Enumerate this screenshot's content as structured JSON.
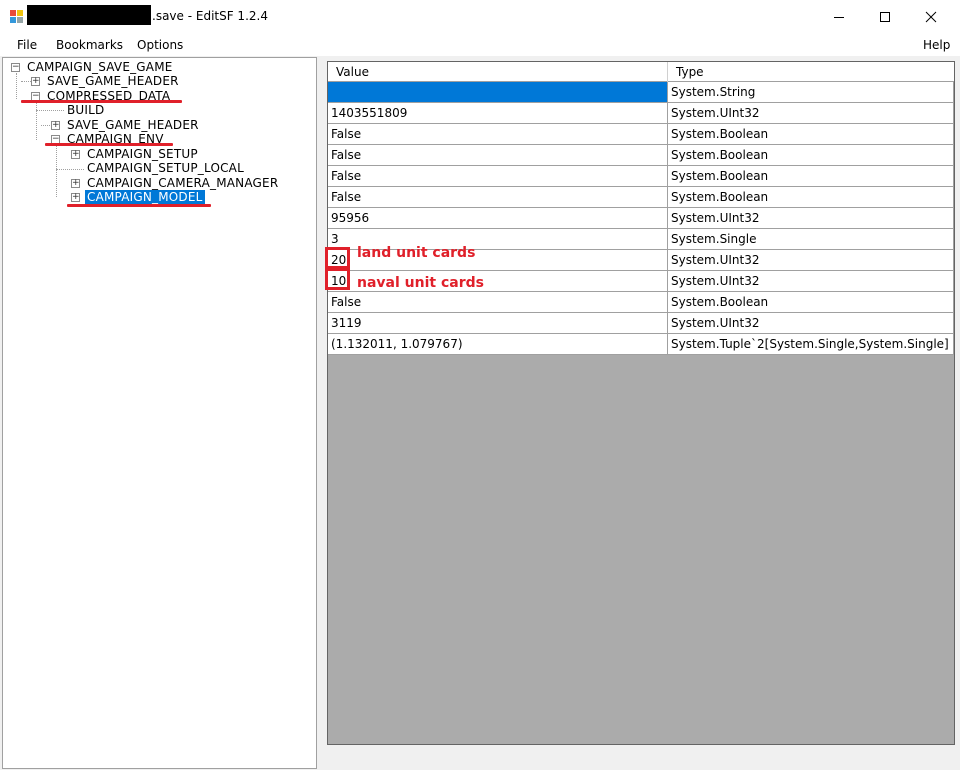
{
  "window": {
    "title_suffix": ".save - EditSF 1.2.4"
  },
  "menu": {
    "file": "File",
    "bookmarks": "Bookmarks",
    "options": "Options",
    "help": "Help"
  },
  "tree": {
    "nodes": [
      {
        "label": "CAMPAIGN_SAVE_GAME",
        "expander": "minus"
      },
      {
        "label": "SAVE_GAME_HEADER",
        "expander": "plus"
      },
      {
        "label": "COMPRESSED_DATA",
        "expander": "minus"
      },
      {
        "label": "BUILD",
        "expander": "none"
      },
      {
        "label": "SAVE_GAME_HEADER",
        "expander": "plus"
      },
      {
        "label": "CAMPAIGN_ENV",
        "expander": "minus"
      },
      {
        "label": "CAMPAIGN_SETUP",
        "expander": "plus"
      },
      {
        "label": "CAMPAIGN_SETUP_LOCAL",
        "expander": "none"
      },
      {
        "label": "CAMPAIGN_CAMERA_MANAGER",
        "expander": "plus"
      },
      {
        "label": "CAMPAIGN_MODEL",
        "expander": "plus",
        "selected": true
      }
    ]
  },
  "grid": {
    "headers": {
      "value": "Value",
      "type": "Type"
    },
    "rows": [
      {
        "value": "",
        "type": "System.String",
        "selected": true
      },
      {
        "value": "1403551809",
        "type": "System.UInt32"
      },
      {
        "value": "False",
        "type": "System.Boolean"
      },
      {
        "value": "False",
        "type": "System.Boolean"
      },
      {
        "value": "False",
        "type": "System.Boolean"
      },
      {
        "value": "False",
        "type": "System.Boolean"
      },
      {
        "value": "95956",
        "type": "System.UInt32"
      },
      {
        "value": "3",
        "type": "System.Single"
      },
      {
        "value": "20",
        "type": "System.UInt32"
      },
      {
        "value": "10",
        "type": "System.UInt32"
      },
      {
        "value": "False",
        "type": "System.Boolean"
      },
      {
        "value": "3119",
        "type": "System.UInt32"
      },
      {
        "value": "(1.132011, 1.079767)",
        "type": "System.Tuple`2[System.Single,System.Single]"
      }
    ]
  },
  "annotations": {
    "land": "land unit cards",
    "naval": "naval unit cards"
  },
  "colors": {
    "selection": "#0078d7",
    "annotation_red": "#e0202a",
    "grid_background": "#ababab"
  }
}
